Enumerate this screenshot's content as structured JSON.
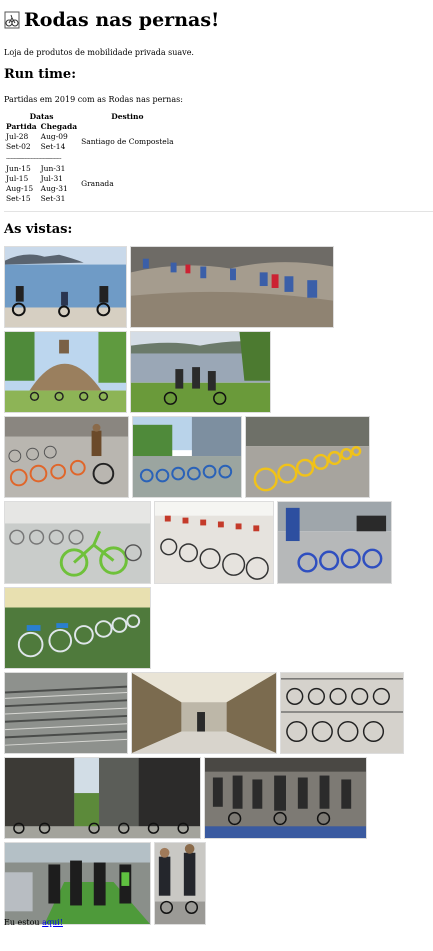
{
  "header": {
    "title": "Rodas nas pernas!",
    "tagline": "Loja de produtos de mobilidade privada suave."
  },
  "runtime": {
    "heading": "Run time:",
    "intro": "Partidas em 2019 com as Rodas nas pernas:",
    "columns": {
      "dates": "Datas",
      "departure": "Partida",
      "arrival": "Chegada",
      "destination": "Destino"
    },
    "separator": "------------------------------------",
    "groups": [
      {
        "destination": "Santiago de Compostela",
        "rows": [
          [
            "Jul-28",
            "Aug-09"
          ],
          [
            "Set-02",
            "Set-14"
          ]
        ]
      },
      {
        "destination": "Granada",
        "rows": [
          [
            "Jun-15",
            "Jun-31"
          ],
          [
            "Jul-15",
            "Jul-31"
          ],
          [
            "Aug-15",
            "Aug-31"
          ],
          [
            "Set-15",
            "Set-31"
          ]
        ]
      }
    ]
  },
  "gallery": {
    "heading": "As vistas:",
    "photos": [
      "photo-cyclists-by-lake",
      "photo-mountain-bike-group",
      "photo-stupa-cyclists",
      "photo-lakeside-riders",
      "photo-orange-share-bikes",
      "photo-blue-dock-bikes",
      "photo-yellow-share-bikes",
      "photo-green-share-bikes",
      "photo-white-dock-bikes",
      "photo-blue-station-bikes",
      "photo-white-bikes-on-green",
      "photo-bike-parking-lot",
      "photo-indoor-bike-garage",
      "photo-two-tier-racks",
      "photo-city-street-cyclists",
      "photo-commuter-crowd",
      "photo-bike-lane-commuters",
      "photo-suited-cyclists"
    ]
  },
  "footer": {
    "text": "Eu estou ",
    "link": "aqui!"
  },
  "colors": {
    "link": "#0000ee",
    "rule": "#e3e3e3"
  }
}
